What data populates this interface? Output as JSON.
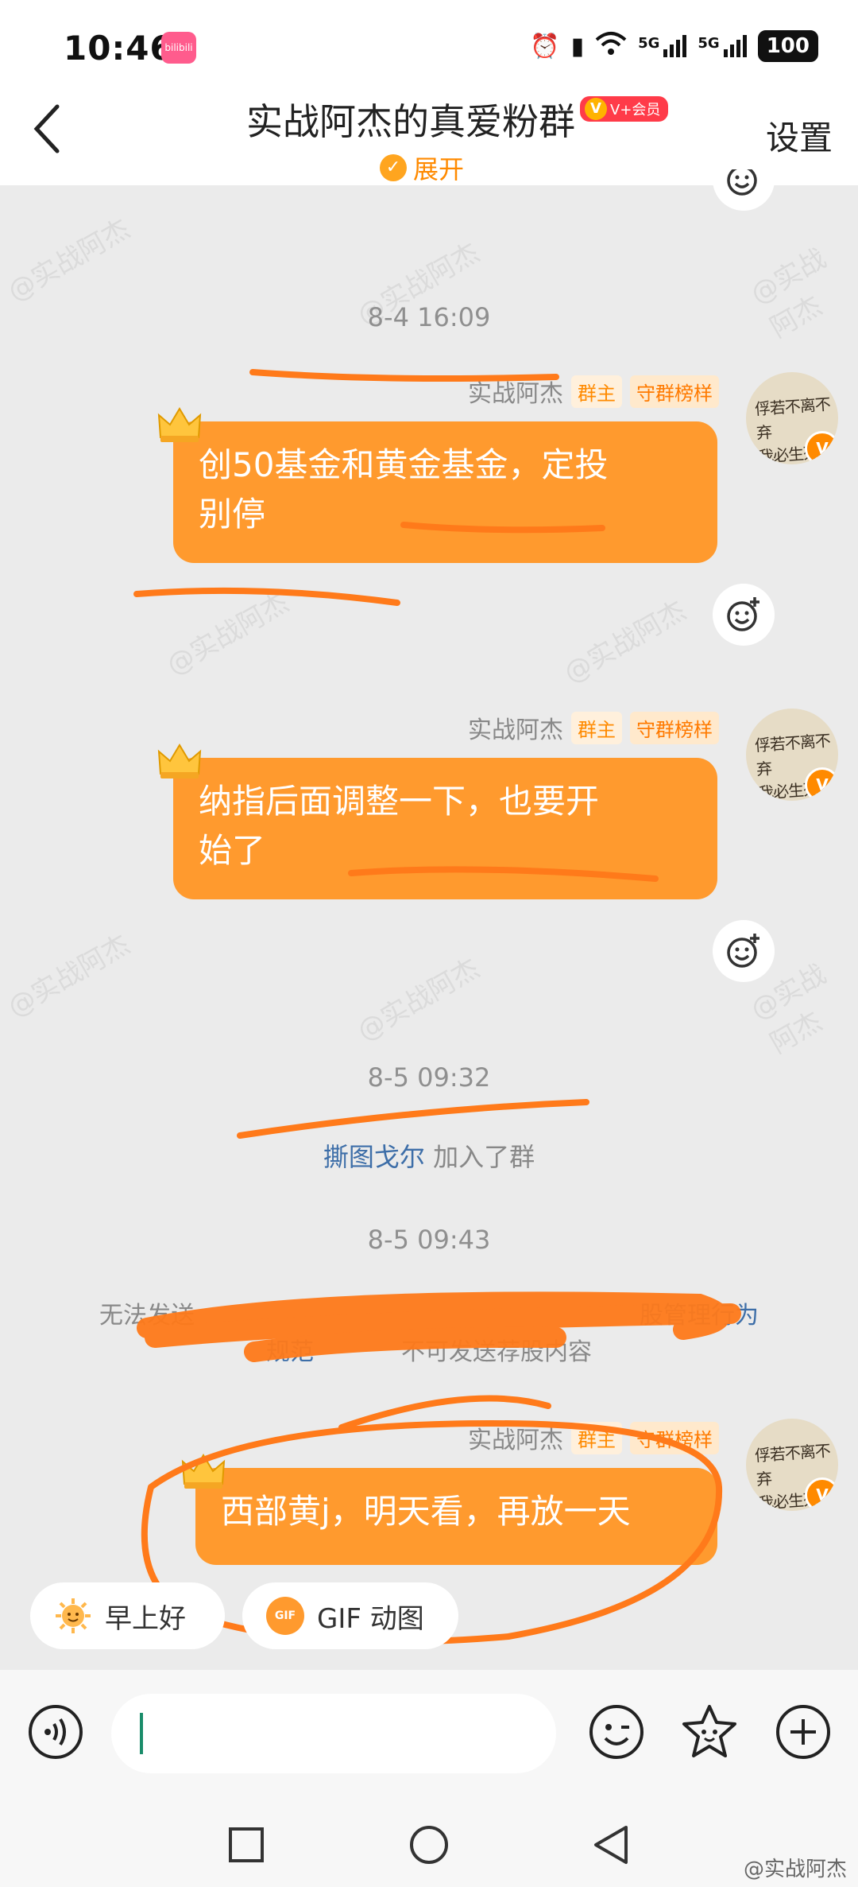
{
  "status_bar": {
    "time": "10:46",
    "app_badge": "bilibili",
    "network_1": "5G",
    "network_2": "5G",
    "battery": "100"
  },
  "header": {
    "back_glyph": "‹",
    "title": "实战阿杰的真爱粉群",
    "vip_label": "V+会员",
    "expand_label": "展开",
    "settings_label": "设置"
  },
  "messages": [
    {
      "timestamp": "8-4 16:09",
      "sender": "实战阿杰",
      "tag_owner": "群主",
      "tag_guard": "守群榜样",
      "line1": "创50基金和黄金基金，定投",
      "line2": "别停"
    },
    {
      "sender": "实战阿杰",
      "tag_owner": "群主",
      "tag_guard": "守群榜样",
      "line1": "纳指后面调整一下，也要开",
      "line2": "始了"
    },
    {
      "timestamp": "8-5 09:32",
      "joined_name": "撕图戈尔",
      "joined_text": "加入了群"
    },
    {
      "timestamp": "8-5 09:43",
      "notice_line1_start": "无法发送",
      "notice_line1_link": "股管理行为",
      "notice_line2_link": "规范",
      "notice_line2_end": "不可发送荐股内容"
    },
    {
      "sender": "实战阿杰",
      "tag_owner": "群主",
      "tag_guard": "守群榜样",
      "line1": "西部黄j，明天看，再放一天"
    }
  ],
  "quick_replies": [
    {
      "label": "早上好"
    },
    {
      "label": "GIF 动图",
      "icon_text": "GIF"
    }
  ],
  "watermark": "@实战阿杰",
  "colors": {
    "accent": "#ff9a2e",
    "annotation": "#ff7a1a",
    "link": "#3d6ea8"
  }
}
